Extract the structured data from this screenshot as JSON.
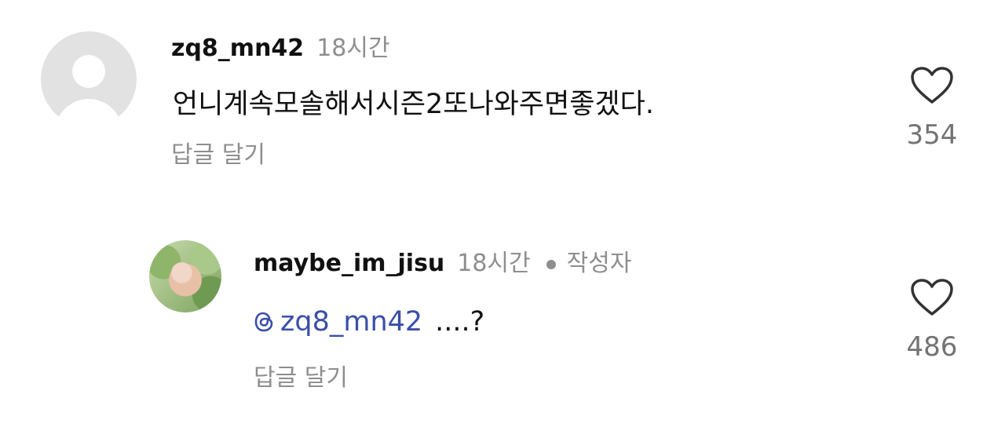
{
  "comments": [
    {
      "username": "zq8_mn42",
      "time": "18시간",
      "text": "언니계속모솔해서시즌2또나와주면좋겠다.",
      "reply_label": "답글 달기",
      "likes": "354",
      "avatar_icon": "default-profile-icon"
    },
    {
      "username": "maybe_im_jisu",
      "time": "18시간",
      "author_badge": "작성자",
      "mention": "zq8_mn42",
      "text": "....?",
      "reply_label": "답글 달기",
      "likes": "486",
      "avatar_icon": "profile-photo"
    }
  ],
  "colors": {
    "mention": "#3a4fa8",
    "muted": "#8e8e8e",
    "text": "#111111"
  }
}
